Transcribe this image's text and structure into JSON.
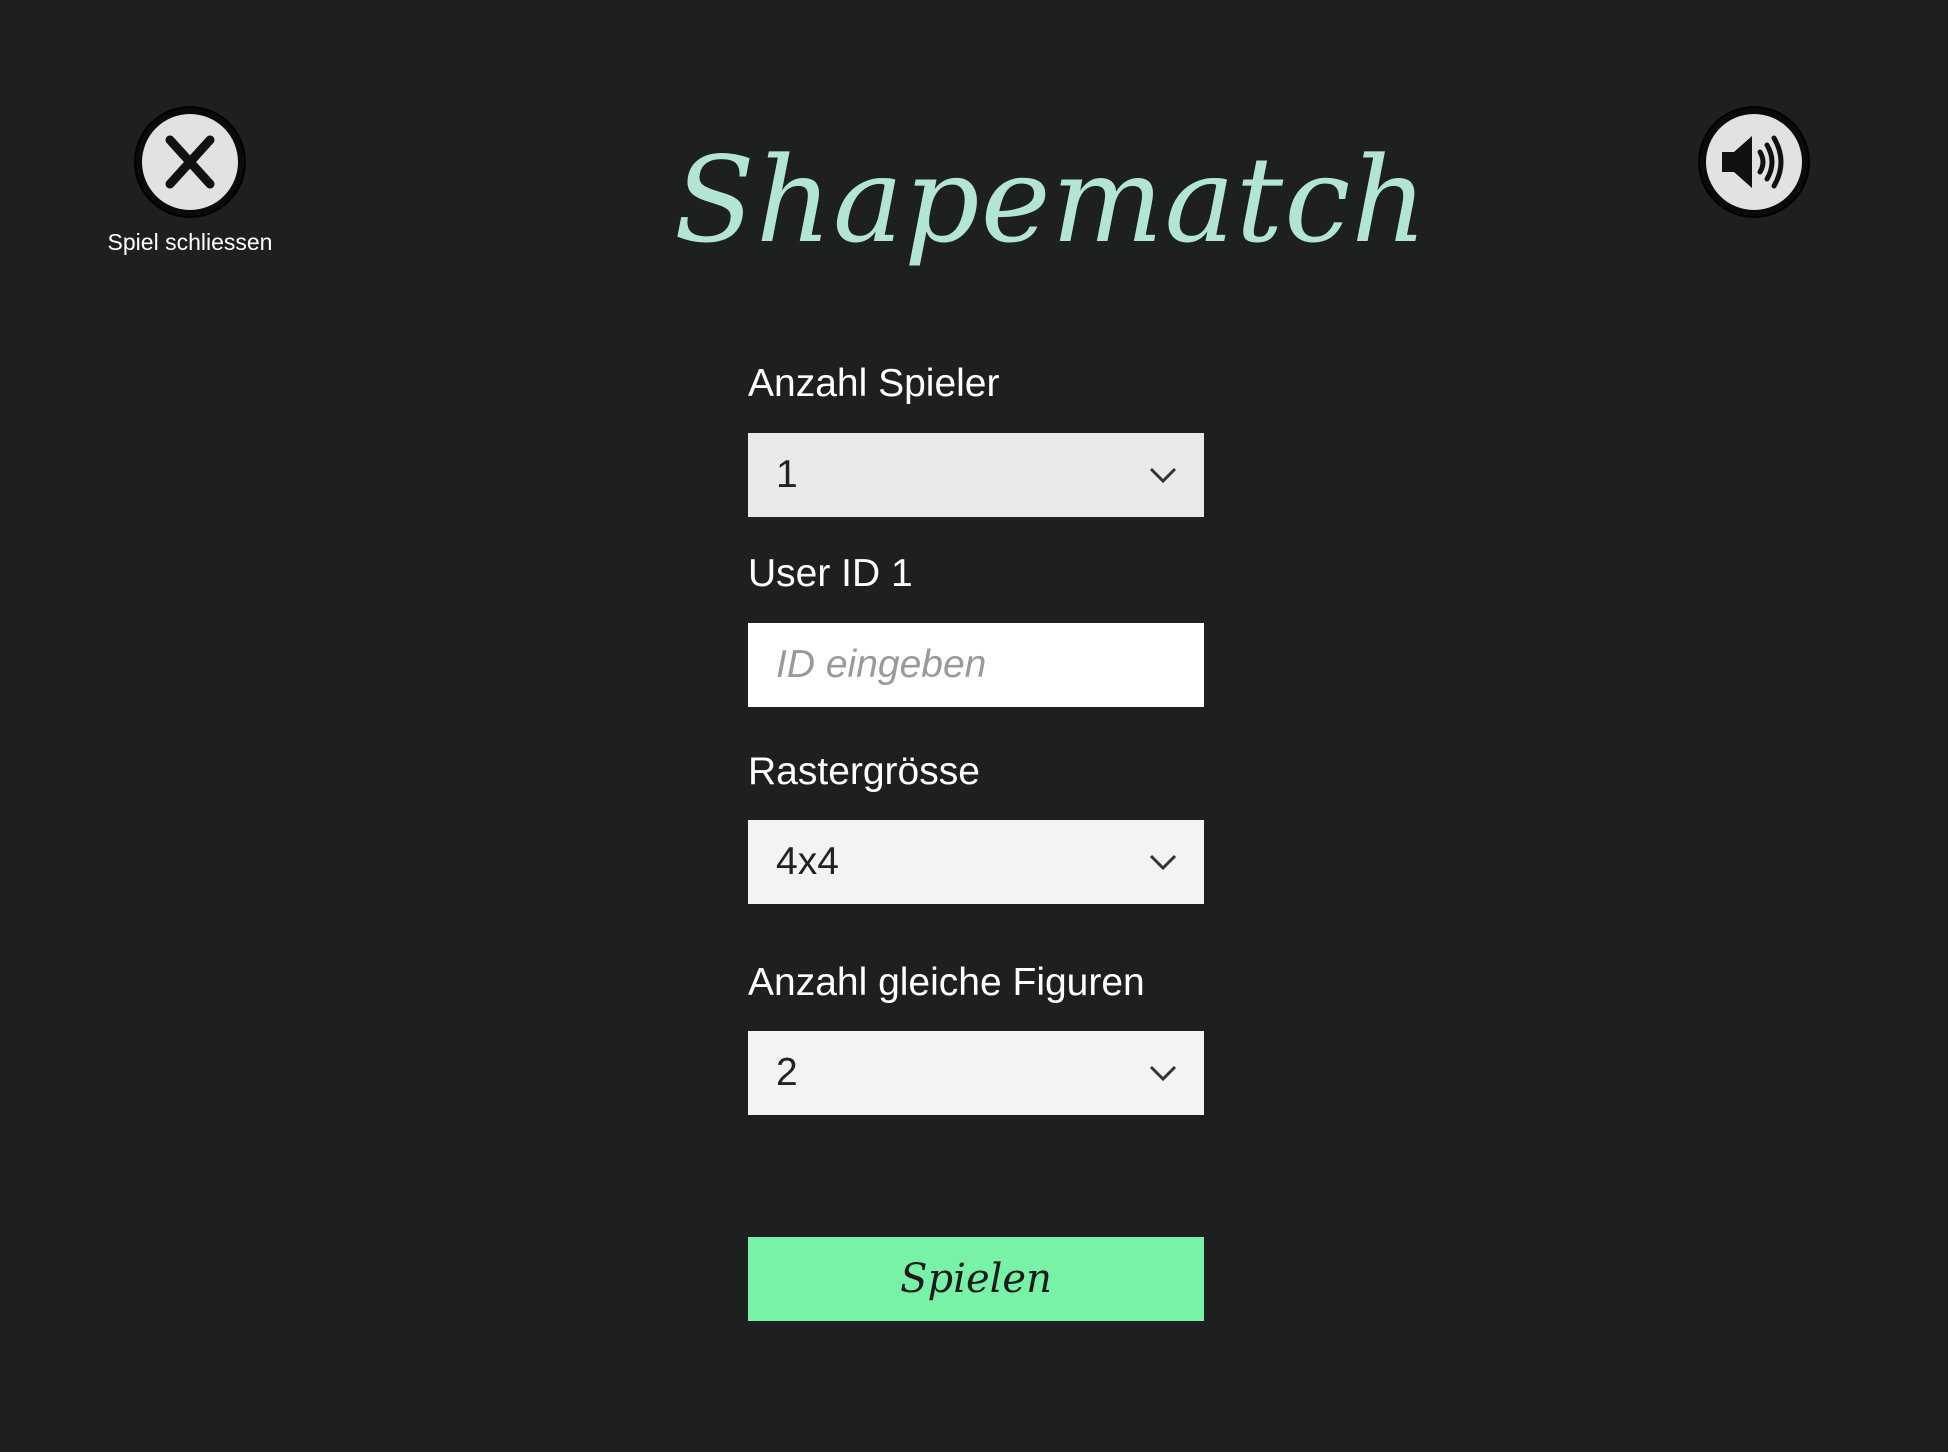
{
  "header": {
    "title": "Shapematch",
    "close_label": "Spiel schliessen",
    "close_icon": "close-x-icon",
    "sound_icon": "speaker-volume-icon"
  },
  "form": {
    "players": {
      "label": "Anzahl Spieler",
      "value": "1"
    },
    "user_id": {
      "label": "User ID 1",
      "value": "",
      "placeholder": "ID eingeben"
    },
    "grid_size": {
      "label": "Rastergrösse",
      "value": "4x4"
    },
    "matching_figures": {
      "label": "Anzahl gleiche Figuren",
      "value": "2"
    },
    "play_label": "Spielen"
  },
  "colors": {
    "background": "#1e1f21",
    "title": "#b3e6d2",
    "play_button": "#78f2a6",
    "select_background": "#f3f3f3"
  }
}
